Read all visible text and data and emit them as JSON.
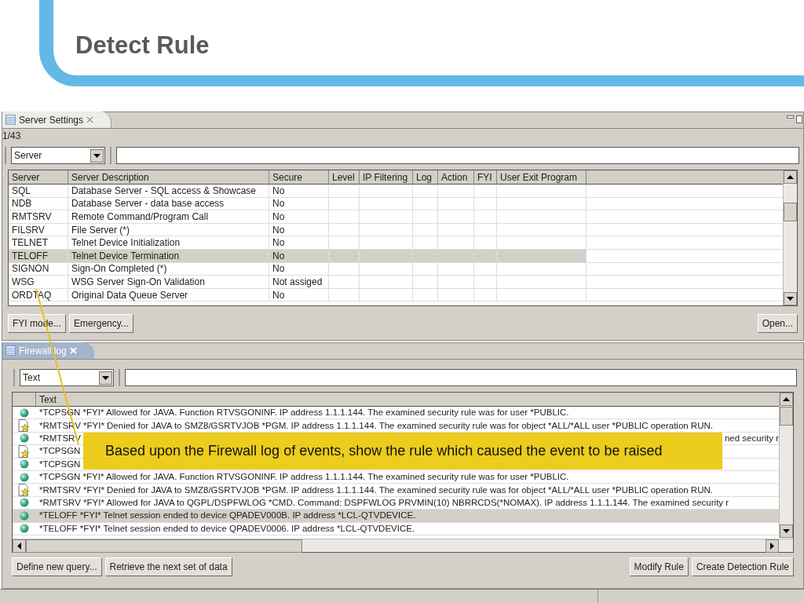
{
  "slide": {
    "title": "Detect Rule"
  },
  "server_panel": {
    "tab": "Server Settings",
    "count": "1/43",
    "filter": {
      "value": "Server"
    },
    "table": {
      "columns": [
        "Server",
        "Server Description",
        "Secure",
        "Level",
        "IP Filtering",
        "Log",
        "Action",
        "FYI",
        "User Exit Program"
      ],
      "rows": [
        {
          "cells": [
            "SQL",
            "Database Server - SQL access & Showcase",
            "No"
          ],
          "selected": false
        },
        {
          "cells": [
            "NDB",
            "Database Server - data base access",
            "No"
          ],
          "selected": false
        },
        {
          "cells": [
            "RMTSRV",
            "Remote Command/Program Call",
            "No"
          ],
          "selected": false
        },
        {
          "cells": [
            "FILSRV",
            "File Server (*)",
            "No"
          ],
          "selected": false
        },
        {
          "cells": [
            "TELNET",
            "Telnet Device Initialization",
            "No"
          ],
          "selected": false
        },
        {
          "cells": [
            "TELOFF",
            "Telnet Device Termination",
            "No"
          ],
          "selected": true
        },
        {
          "cells": [
            "SIGNON",
            "Sign-On Completed (*)",
            "No"
          ],
          "selected": false
        },
        {
          "cells": [
            "WSG",
            "WSG Server Sign-On Validation",
            "Not assiged"
          ],
          "selected": false
        },
        {
          "cells": [
            "ORDTAQ",
            "Original Data Queue Server",
            "No"
          ],
          "selected": false
        }
      ]
    },
    "buttons": [
      "FYI mode...",
      "Emergency..."
    ],
    "open_button": "Open..."
  },
  "log_panel": {
    "tab": "Firewall log",
    "filter": {
      "value": "Text"
    },
    "table": {
      "columns": [
        "Text"
      ],
      "rows": [
        {
          "kind": "allowed",
          "text": "*TCPSGN *FYI* Allowed for JAVA. Function RTVSGONINF. IP address 1.1.1.144. The examined security rule was for user *PUBLIC.",
          "selected": false
        },
        {
          "kind": "denied",
          "text": "*RMTSRV *FYI* Denied for JAVA to SMZ8/GSRTVJOB *PGM. IP address 1.1.1.144. The examined security rule was for object *ALL/*ALL user *PUBLIC operation RUN.",
          "selected": false
        },
        {
          "kind": "allowed",
          "text": "*RMTSRV",
          "tail": "ned security r",
          "selected": false
        },
        {
          "kind": "denied",
          "text": "*TCPSGN",
          "selected": false
        },
        {
          "kind": "allowed",
          "text": "*TCPSGN",
          "selected": false
        },
        {
          "kind": "allowed",
          "text": "*TCPSGN *FYI* Allowed for JAVA. Function RTVSGONINF. IP address 1.1.1.144. The examined security rule was for user *PUBLIC.",
          "selected": false
        },
        {
          "kind": "denied",
          "text": "*RMTSRV *FYI* Denied for JAVA to SMZ8/GSRTVJOB *PGM. IP address 1.1.1.144. The examined security rule was for object *ALL/*ALL user *PUBLIC operation RUN.",
          "selected": false
        },
        {
          "kind": "allowed",
          "text": "*RMTSRV *FYI* Allowed for JAVA to QGPL/DSPFWLOG *CMD. Command: DSPFWLOG PRVMIN(10) NBRRCDS(*NOMAX). IP address 1.1.1.144. The examined security r",
          "selected": false
        },
        {
          "kind": "allowed",
          "text": "*TELOFF *FYI* Telnet session ended to device QPADEV000B. IP address *LCL-QTVDEVICE.",
          "selected": true
        },
        {
          "kind": "allowed",
          "text": "*TELOFF *FYI* Telnet session ended to device QPADEV0006. IP address *LCL-QTVDEVICE.",
          "selected": false
        }
      ]
    },
    "buttons": [
      "Define new query...",
      "Retrieve the next set of data"
    ],
    "right_buttons": [
      "Modify Rule",
      "Create Detection Rule"
    ]
  },
  "callout": "Based upon the Firewall log of events, show the rule which caused the event to be raised"
}
